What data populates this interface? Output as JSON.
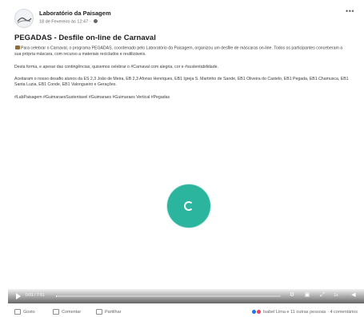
{
  "colors": {
    "spinner": "#2bb59e",
    "text": "#1c1e21",
    "muted": "#65676b",
    "like": "#1877f2",
    "love": "#f33e58"
  },
  "header": {
    "page_name": "Laboratório da Paisagem",
    "timestamp": "18 de Fevereiro às 12:47 ·",
    "more_icon": "more-horizontal-icon"
  },
  "post": {
    "title": "PEGADAS - Desfile on-line de Carnaval",
    "paragraphs": [
      "Para celebrar o Carnaval, o programa PEGADAS, coordenado pelo Laboratório da Paisagem, organizou um desfile de máscaras on-line. Todos os participantes conceberam a sua própria máscara, com recurso a materiais reciclados e reutilizáveis.",
      "Desta forma, e apesar das contingências, quisemos celebrar o #Carnaval com alegria, cor e #sustentabilidade.",
      "Aceitaram o nosso desafio alunos da ES 2,3 João de Meira, EB 2,3 Afonso Henriques, EB1 Igreja S. Martinho de Sande, EB1 Oliveira do Castelo, EB1 Pegada, EB1 Chamusca, EB1 Santa Luzia, EB1 Conde, EB1 Valongueiro e Gerações.",
      "#LabPaisagem #GuimaraesSustentavel #Guimaraes #Guimaraes Vertical #Pegadas"
    ]
  },
  "video": {
    "time": "0:01 / 7:51",
    "progress": 0.004,
    "speed": "1x",
    "icons": [
      "play-icon",
      "settings-icon",
      "picture-in-picture-icon",
      "fullscreen-icon",
      "volume-icon"
    ]
  },
  "footer": {
    "like_label": "Gosto",
    "comment_label": "Comentar",
    "share_label": "Partilhar",
    "reactions_text": "Isabel Lima e 11 outras pessoas · 4 comentários"
  }
}
